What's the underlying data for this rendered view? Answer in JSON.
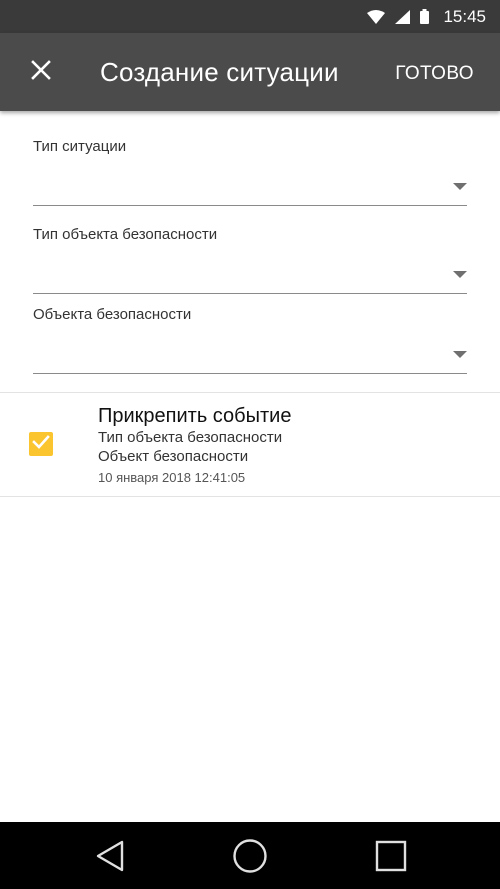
{
  "status_bar": {
    "time": "15:45",
    "icons": [
      "wifi-icon",
      "signal-icon",
      "battery-icon"
    ]
  },
  "app_bar": {
    "close_icon": "close-icon",
    "title": "Создание ситуации",
    "done_label": "ГОТОВО"
  },
  "form": {
    "fields": [
      {
        "label": "Тип ситуации",
        "value": ""
      },
      {
        "label": "Тип объекта безопасности",
        "value": ""
      },
      {
        "label": "Объекта безопасности",
        "value": ""
      }
    ]
  },
  "attach": {
    "checked": true,
    "title": "Прикрепить событие",
    "line1": "Тип объекта безопасности",
    "line2": "Объект безопасности",
    "timestamp": "10 января 2018  12:41:05"
  },
  "nav_bar": {
    "icons": [
      "back-icon",
      "home-icon",
      "recents-icon"
    ]
  },
  "colors": {
    "status_bar": "#3a3a3a",
    "app_bar": "#4b4b4b",
    "accent": "#fbc530",
    "nav_bar": "#000000"
  }
}
